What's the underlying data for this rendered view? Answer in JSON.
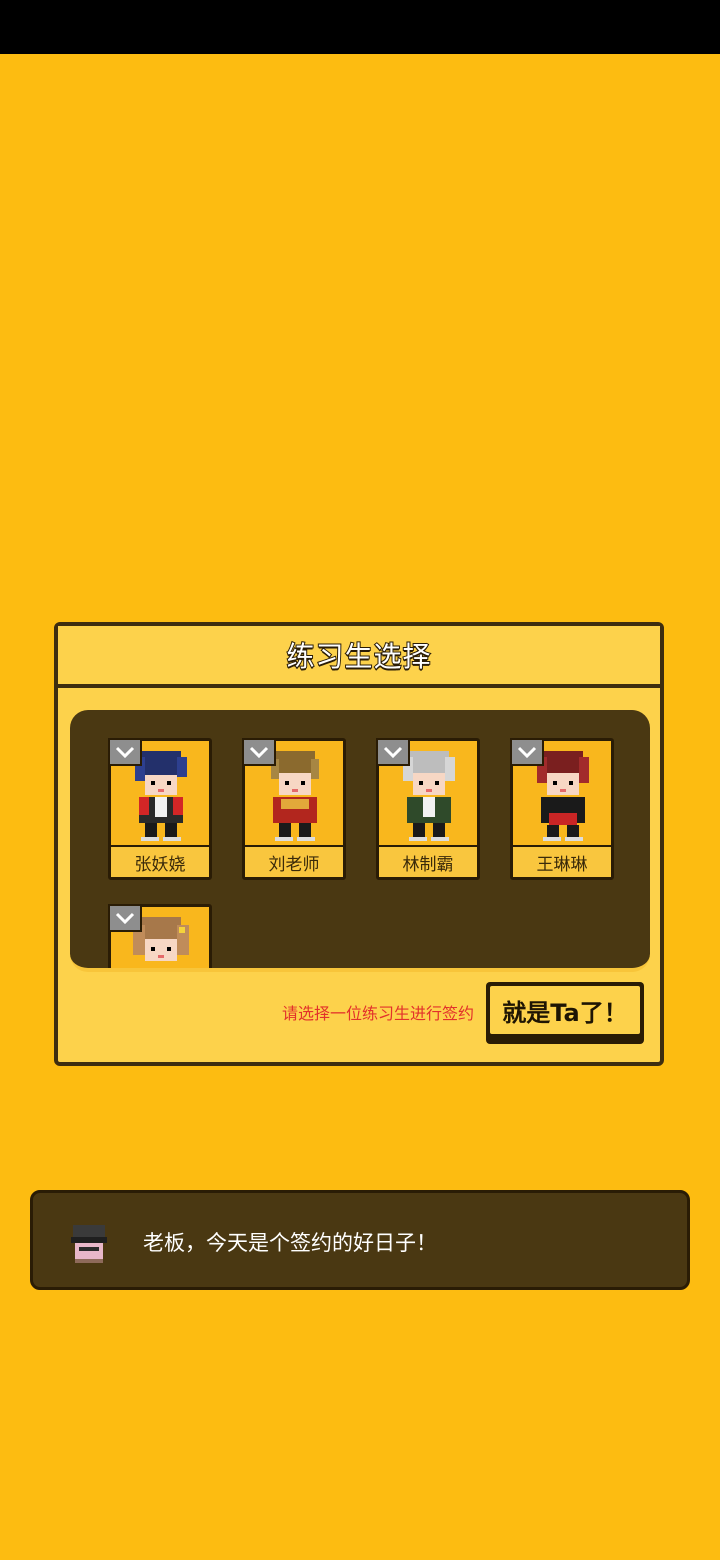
{
  "dialog": {
    "title": "练习生选择",
    "trainees": [
      {
        "name": "张妖娆"
      },
      {
        "name": "刘老师"
      },
      {
        "name": "林制霸"
      },
      {
        "name": "王琳琳"
      },
      {
        "name": ""
      }
    ],
    "hint": "请选择一位练习生进行签约",
    "confirm_label": "就是Ta了！"
  },
  "speech": {
    "text": "老板，今天是个签约的好日子！"
  },
  "icons": {
    "card_badge": "chevron-down-icon",
    "speaker": "manager-avatar-icon"
  },
  "colors": {
    "background": "#FDBC11",
    "panel": "#4A3812",
    "hint": "#E2312B"
  }
}
